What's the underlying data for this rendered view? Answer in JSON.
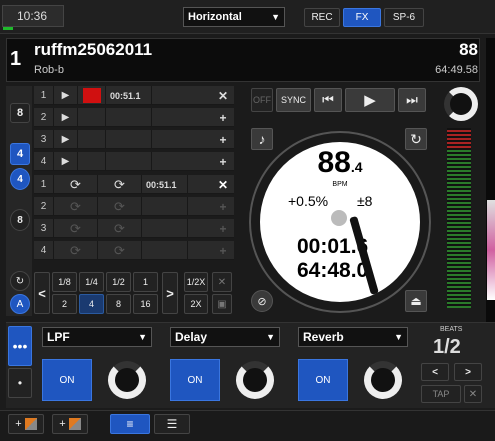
{
  "top": {
    "time": "10:36",
    "layout_value": "Horizontal",
    "buttons": [
      "REC",
      "FX",
      "SP-6"
    ]
  },
  "deck": {
    "number": "1",
    "title": "ruffm25062011",
    "artist": "Rob-b",
    "bpm_top": "88",
    "remaining_top": "64:49.58"
  },
  "sampler": {
    "deck_badges": [
      "8",
      "4",
      "4",
      "8"
    ],
    "cue_rows": [
      {
        "num": "1",
        "time": "00:51.1",
        "has_red": true,
        "action": "✕"
      },
      {
        "num": "2",
        "time": "",
        "has_red": false,
        "action": "+"
      },
      {
        "num": "3",
        "time": "",
        "has_red": false,
        "action": "+"
      },
      {
        "num": "4",
        "time": "",
        "has_red": false,
        "action": "+"
      }
    ],
    "loop_rows": [
      {
        "num": "1",
        "time": "00:51.1",
        "action": "✕"
      },
      {
        "num": "2",
        "time": "",
        "action": "+"
      },
      {
        "num": "3",
        "time": "",
        "action": "+"
      },
      {
        "num": "4",
        "time": "",
        "action": "+"
      }
    ],
    "loop_sizes_top": [
      "1/8",
      "1/4",
      "1/2",
      "1",
      "1/2X"
    ],
    "loop_sizes_bottom": [
      "2",
      "4",
      "8",
      "16",
      "2X"
    ],
    "prev_symbol": "<",
    "next_symbol": ">",
    "close_symbol": "✕"
  },
  "transport": {
    "off": "OFF",
    "sync": "SYNC",
    "prev": "⏮",
    "play": "▶",
    "next": "⏭"
  },
  "platter": {
    "bpm": "88",
    "bpm_decimal": ".4",
    "bpm_unit": "BPM",
    "pitch": "+0.5%",
    "pitch_range": "±8",
    "elapsed": "00:01.6",
    "remaining": "64:48.0"
  },
  "fx": {
    "slots": [
      {
        "name": "LPF",
        "on_label": "ON"
      },
      {
        "name": "Delay",
        "on_label": "ON"
      },
      {
        "name": "Reverb",
        "on_label": "ON"
      }
    ],
    "beats_label": "BEATS",
    "beats_value": "1/2",
    "tap": "TAP",
    "x": "✕"
  },
  "bottom": {
    "plus": "+",
    "plus2": "+"
  },
  "colors": {
    "accent": "#1f56c0",
    "red": "#d01010"
  }
}
